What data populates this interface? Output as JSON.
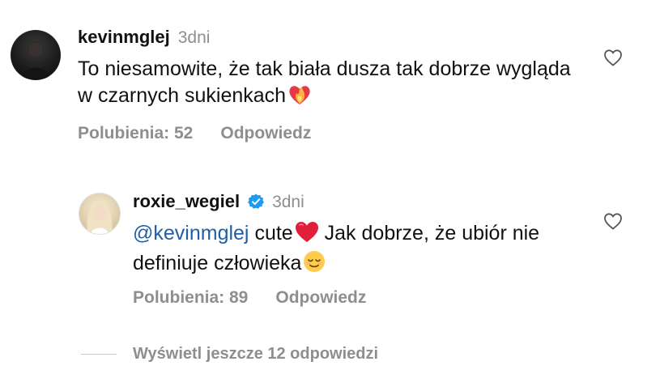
{
  "comments": [
    {
      "username": "kevinmglej",
      "time": "3dni",
      "text": "To niesamowite, że tak biała dusza tak dobrze wygląda w czarnych sukienkach",
      "emoji_icon": "heart-on-fire-emoji",
      "likes": "Polubienia: 52",
      "reply": "Odpowiedz"
    },
    {
      "username": "roxie_wegiel",
      "verified": true,
      "time": "3dni",
      "mention": "@kevinmglej",
      "text_part1": "cute",
      "text_part2": "Jak dobrze, że ubiór nie definiuje człowieka",
      "emoji_icons": [
        "red-heart-emoji",
        "relieved-face-emoji"
      ],
      "likes": "Polubienia: 89",
      "reply": "Odpowiedz"
    }
  ],
  "more_replies": "Wyświetl jeszcze 12 odpowiedzi",
  "colors": {
    "text": "#111111",
    "secondary": "#8e8e8e",
    "mention": "#1f5fa8",
    "verified": "#1d9bf0",
    "heart": "#e0245e"
  }
}
